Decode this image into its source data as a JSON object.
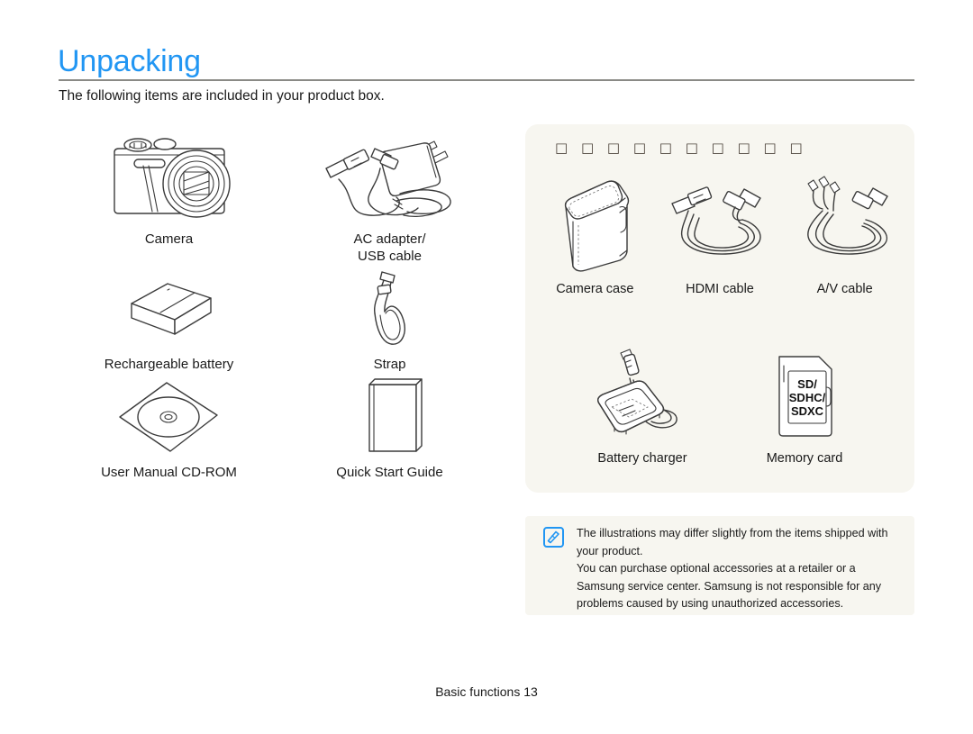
{
  "page": {
    "title": "Unpacking",
    "intro": "The following items are included in your product box.",
    "footer": "Basic functions 13"
  },
  "included_items": [
    {
      "label": "Camera",
      "icon": "camera-illustration"
    },
    {
      "label": "AC adapter/\nUSB cable",
      "label_line1": "AC adapter/",
      "label_line2": "USB cable",
      "icon": "ac-adapter-usb-cable-illustration"
    },
    {
      "label": "Rechargeable battery",
      "icon": "battery-illustration"
    },
    {
      "label": "Strap",
      "icon": "strap-illustration"
    },
    {
      "label": "User Manual CD-ROM",
      "icon": "cd-rom-illustration"
    },
    {
      "label": "Quick Start Guide",
      "icon": "quick-start-guide-illustration"
    }
  ],
  "optional_panel": {
    "title": "□ □ □ □ □ □ □ □ □ □",
    "title_note": "missing-glyph-boxes",
    "background_color": "#f7f6f0",
    "items": [
      {
        "label": "Camera case",
        "icon": "camera-case-illustration"
      },
      {
        "label": "HDMI cable",
        "icon": "hdmi-cable-illustration"
      },
      {
        "label": "A/V cable",
        "icon": "av-cable-illustration"
      },
      {
        "label": "Battery charger",
        "icon": "battery-charger-illustration"
      },
      {
        "label": "Memory card",
        "icon": "memory-card-illustration"
      }
    ],
    "memory_card_text": {
      "line1": "SD/",
      "line2": "SDHC/",
      "line3": "SDXC"
    }
  },
  "note": {
    "icon": "note-pen-icon",
    "icon_color": "#2196f3",
    "paragraph1": "The illustrations may differ slightly from the items shipped with your product.",
    "paragraph2": "You can purchase optional accessories at a retailer or a Samsung service center. Samsung is not responsible for any problems caused by using unauthorized accessories."
  },
  "colors": {
    "title": "#2196f3",
    "rule": "#8a8a86",
    "panel_bg": "#f7f6f0",
    "text": "#1a1a1a"
  }
}
